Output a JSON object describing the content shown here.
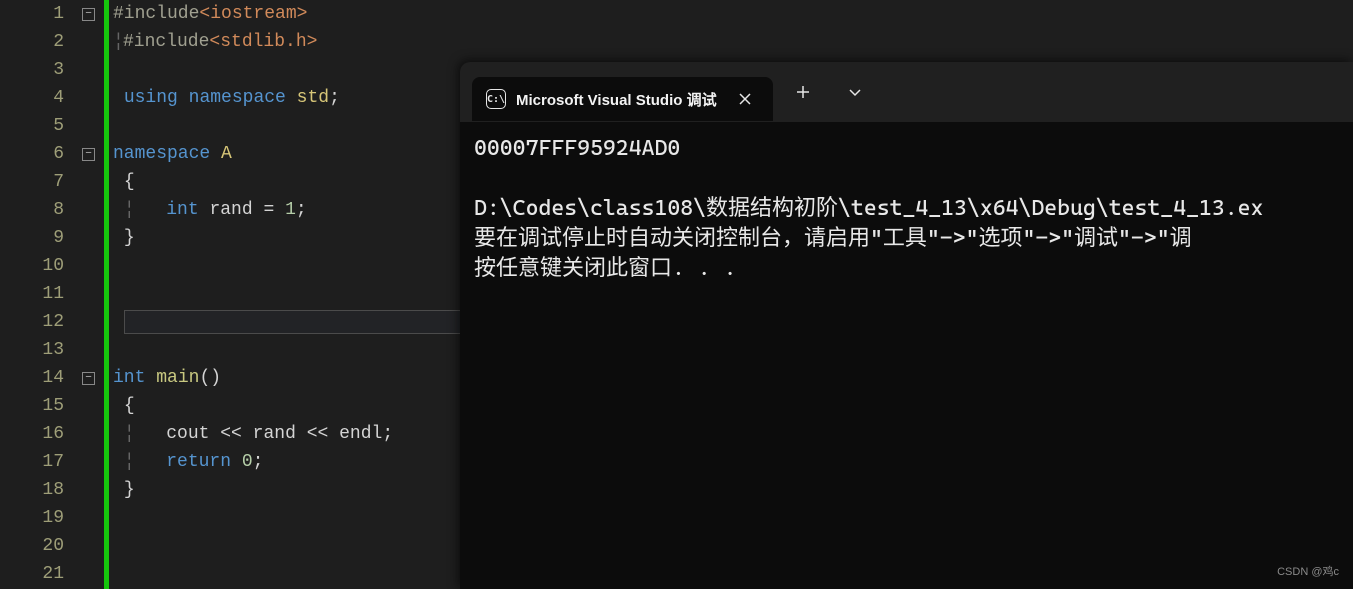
{
  "editor": {
    "line_numbers": [
      "1",
      "2",
      "3",
      "4",
      "5",
      "6",
      "7",
      "8",
      "9",
      "10",
      "11",
      "12",
      "13",
      "14",
      "15",
      "16",
      "17",
      "18",
      "19",
      "20",
      "21"
    ],
    "current_line_index": 11,
    "fold_markers": [
      {
        "glyph": "−",
        "lineIndex": 0
      },
      {
        "glyph": "−",
        "lineIndex": 5
      },
      {
        "glyph": "−",
        "lineIndex": 13
      }
    ],
    "code": {
      "l1_hash": "#include",
      "l1_inc": "<iostream>",
      "l2_hash": "#include",
      "l2_inc": "<stdlib.h>",
      "l4_using": "using",
      "l4_namespace": "namespace",
      "l4_std": "std",
      "l4_semi": ";",
      "l6_namespace": "namespace",
      "l6_A": "A",
      "l7_brace": "{",
      "l8_int": "int",
      "l8_rand": "rand",
      "l8_eq": "=",
      "l8_val": "1",
      "l8_semi": ";",
      "l9_brace": "}",
      "l14_int": "int",
      "l14_main": "main",
      "l14_parens": "()",
      "l15_brace": "{",
      "l16_cout": "cout",
      "l16_o1": "<<",
      "l16_rand": "rand",
      "l16_o2": "<<",
      "l16_endl": "endl",
      "l16_semi": ";",
      "l17_return": "return",
      "l17_zero": "0",
      "l17_semi": ";",
      "l18_brace": "}"
    }
  },
  "terminal": {
    "tab_title": "Microsoft Visual Studio 调试",
    "output_address": "00007FFF95924AD0",
    "blank": "",
    "output_path": "D:\\Codes\\class108\\数据结构初阶\\test_4_13\\x64\\Debug\\test_4_13.ex",
    "output_hint": "要在调试停止时自动关闭控制台，请启用\"工具\"->\"选项\"->\"调试\"->\"调",
    "output_press": "按任意键关闭此窗口. . .",
    "terminal_icon_text": "C:\\"
  },
  "watermark": "CSDN @鸡c"
}
